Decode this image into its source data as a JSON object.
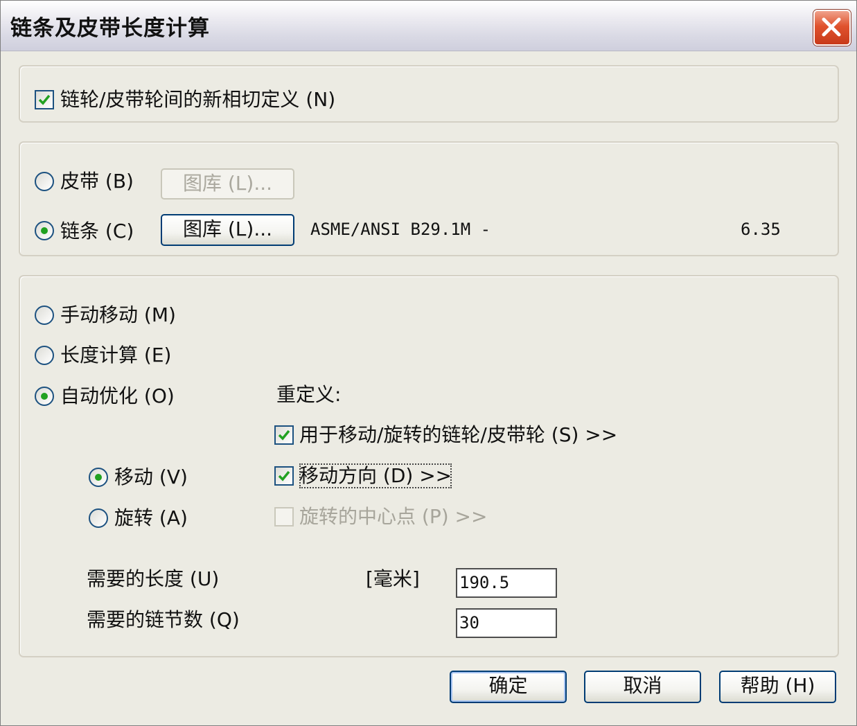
{
  "window": {
    "title": "链条及皮带长度计算"
  },
  "tangency": {
    "label": "链轮/皮带轮间的新相切定义 (N)",
    "checked": true
  },
  "belt": {
    "label": "皮带 (B)",
    "library_button": "图库 (L)..."
  },
  "chain": {
    "label": "链条 (C)",
    "library_button": "图库 (L)...",
    "standard": "ASME/ANSI B29.1M -",
    "pitch": "6.35"
  },
  "mode": {
    "manual_label": "手动移动 (M)",
    "length_label": "长度计算 (E)",
    "auto_label": "自动优化 (O)",
    "selected": "auto"
  },
  "redefine": {
    "heading": "重定义:",
    "sprockets_label": "用于移动/旋转的链轮/皮带轮 (S) >>",
    "direction_label": "移动方向 (D) >>",
    "center_label": "旋转的中心点 (P) >>"
  },
  "motion": {
    "move_label": "移动 (V)",
    "rotate_label": "旋转 (A)",
    "selected": "move"
  },
  "length": {
    "label": "需要的长度 (U)",
    "unit": "[毫米]",
    "value": "190.5"
  },
  "links": {
    "label": "需要的链节数 (Q)",
    "value": "30"
  },
  "buttons": {
    "ok": "确定",
    "cancel": "取消",
    "help": "帮助 (H)"
  }
}
